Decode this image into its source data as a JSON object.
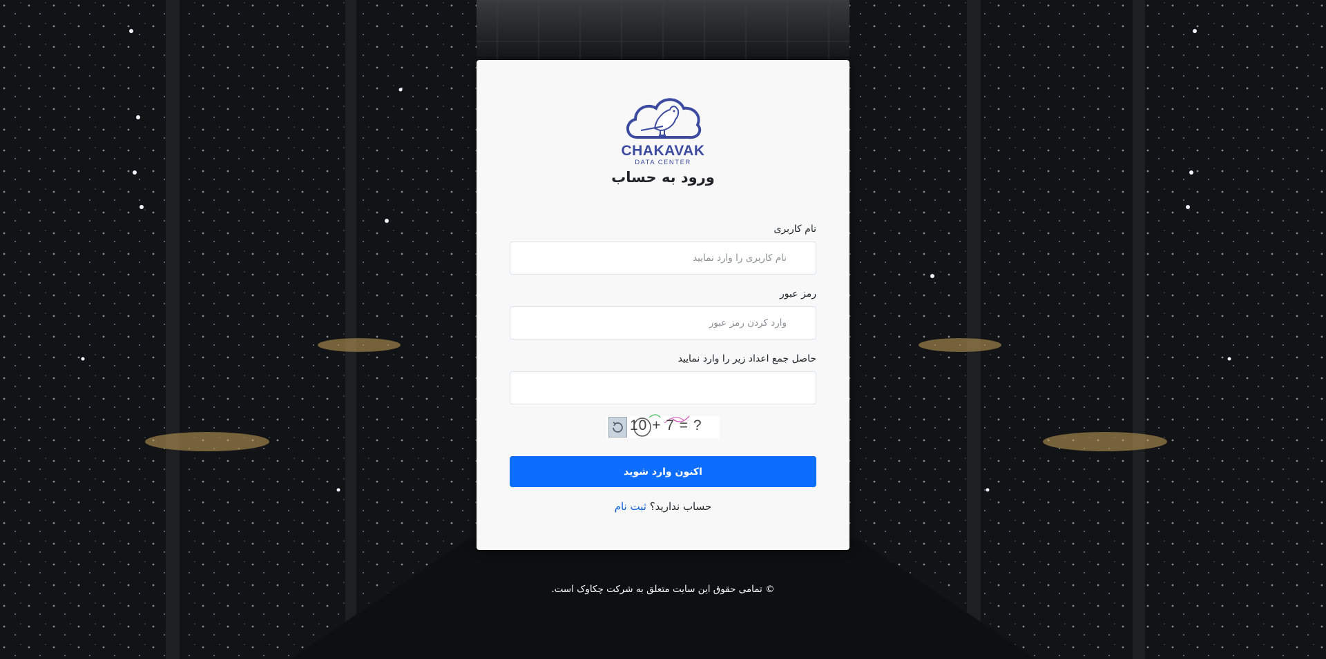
{
  "brand": {
    "name": "CHAKAVAK",
    "sub": "DATA CENTER",
    "color": "#3c4aa0"
  },
  "login": {
    "title": "ورود به حساب",
    "username": {
      "label": "نام کاربری",
      "placeholder": "نام کاربری را وارد نمایید",
      "value": ""
    },
    "password": {
      "label": "رمز عبور",
      "placeholder": "وارد کردن رمز عبور",
      "value": ""
    },
    "captcha": {
      "label": "حاصل جمع اعداد زیر را وارد نمایید",
      "value": "",
      "expression": "10 + 7 = ?"
    },
    "submit_label": "اکنون وارد شوید",
    "signup_prompt": "حساب ندارید؟",
    "signup_link": "ثبت نام"
  },
  "footer": {
    "text": "© تمامی حقوق این سایت متعلق به شرکت چکاوک است."
  },
  "colors": {
    "primary": "#0d6efd",
    "link": "#0b5ed7",
    "card_bg": "#f8f8f8"
  }
}
